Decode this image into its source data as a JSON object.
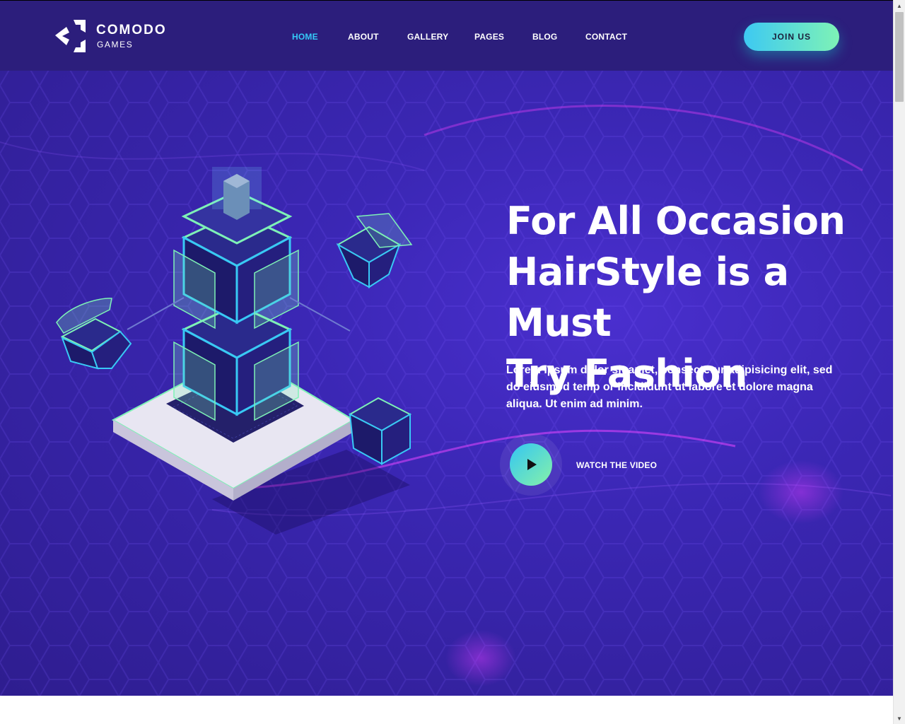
{
  "brand": {
    "title": "COMODO",
    "subtitle": "GAMES",
    "icon": "comodo-logo-mark"
  },
  "nav": {
    "items": [
      {
        "label": "HOME",
        "active": true
      },
      {
        "label": "ABOUT",
        "active": false
      },
      {
        "label": "GALLERY",
        "active": false
      },
      {
        "label": "PAGES",
        "active": false
      },
      {
        "label": "BLOG",
        "active": false
      },
      {
        "label": "CONTACT",
        "active": false
      }
    ],
    "join_label": "JOIN US"
  },
  "hero": {
    "headline": [
      "For All Occasion",
      "HairStyle is a Must",
      "Try Fashion"
    ],
    "description": "Lorem ipsum dolor sit amet, consectetur adipisicing elit, sed do eiusmod temp or incididunt ut labore et dolore magna aliqua. Ut enim ad minim.",
    "watch_label": "WATCH THE VIDEO",
    "play_icon": "play-icon",
    "illustration": "isometric-server-tower-illustration"
  },
  "scrollbar": {
    "up_icon": "scroll-up-arrow-icon",
    "down_icon": "scroll-down-arrow-icon"
  },
  "colors": {
    "header_bg": "#2c1e7c",
    "hero_bg": "#3b27b5",
    "nav_active": "#35c9f7",
    "accent_gradient_start": "#3dc9f2",
    "accent_gradient_end": "#7ef2b6",
    "text": "#ffffff"
  }
}
